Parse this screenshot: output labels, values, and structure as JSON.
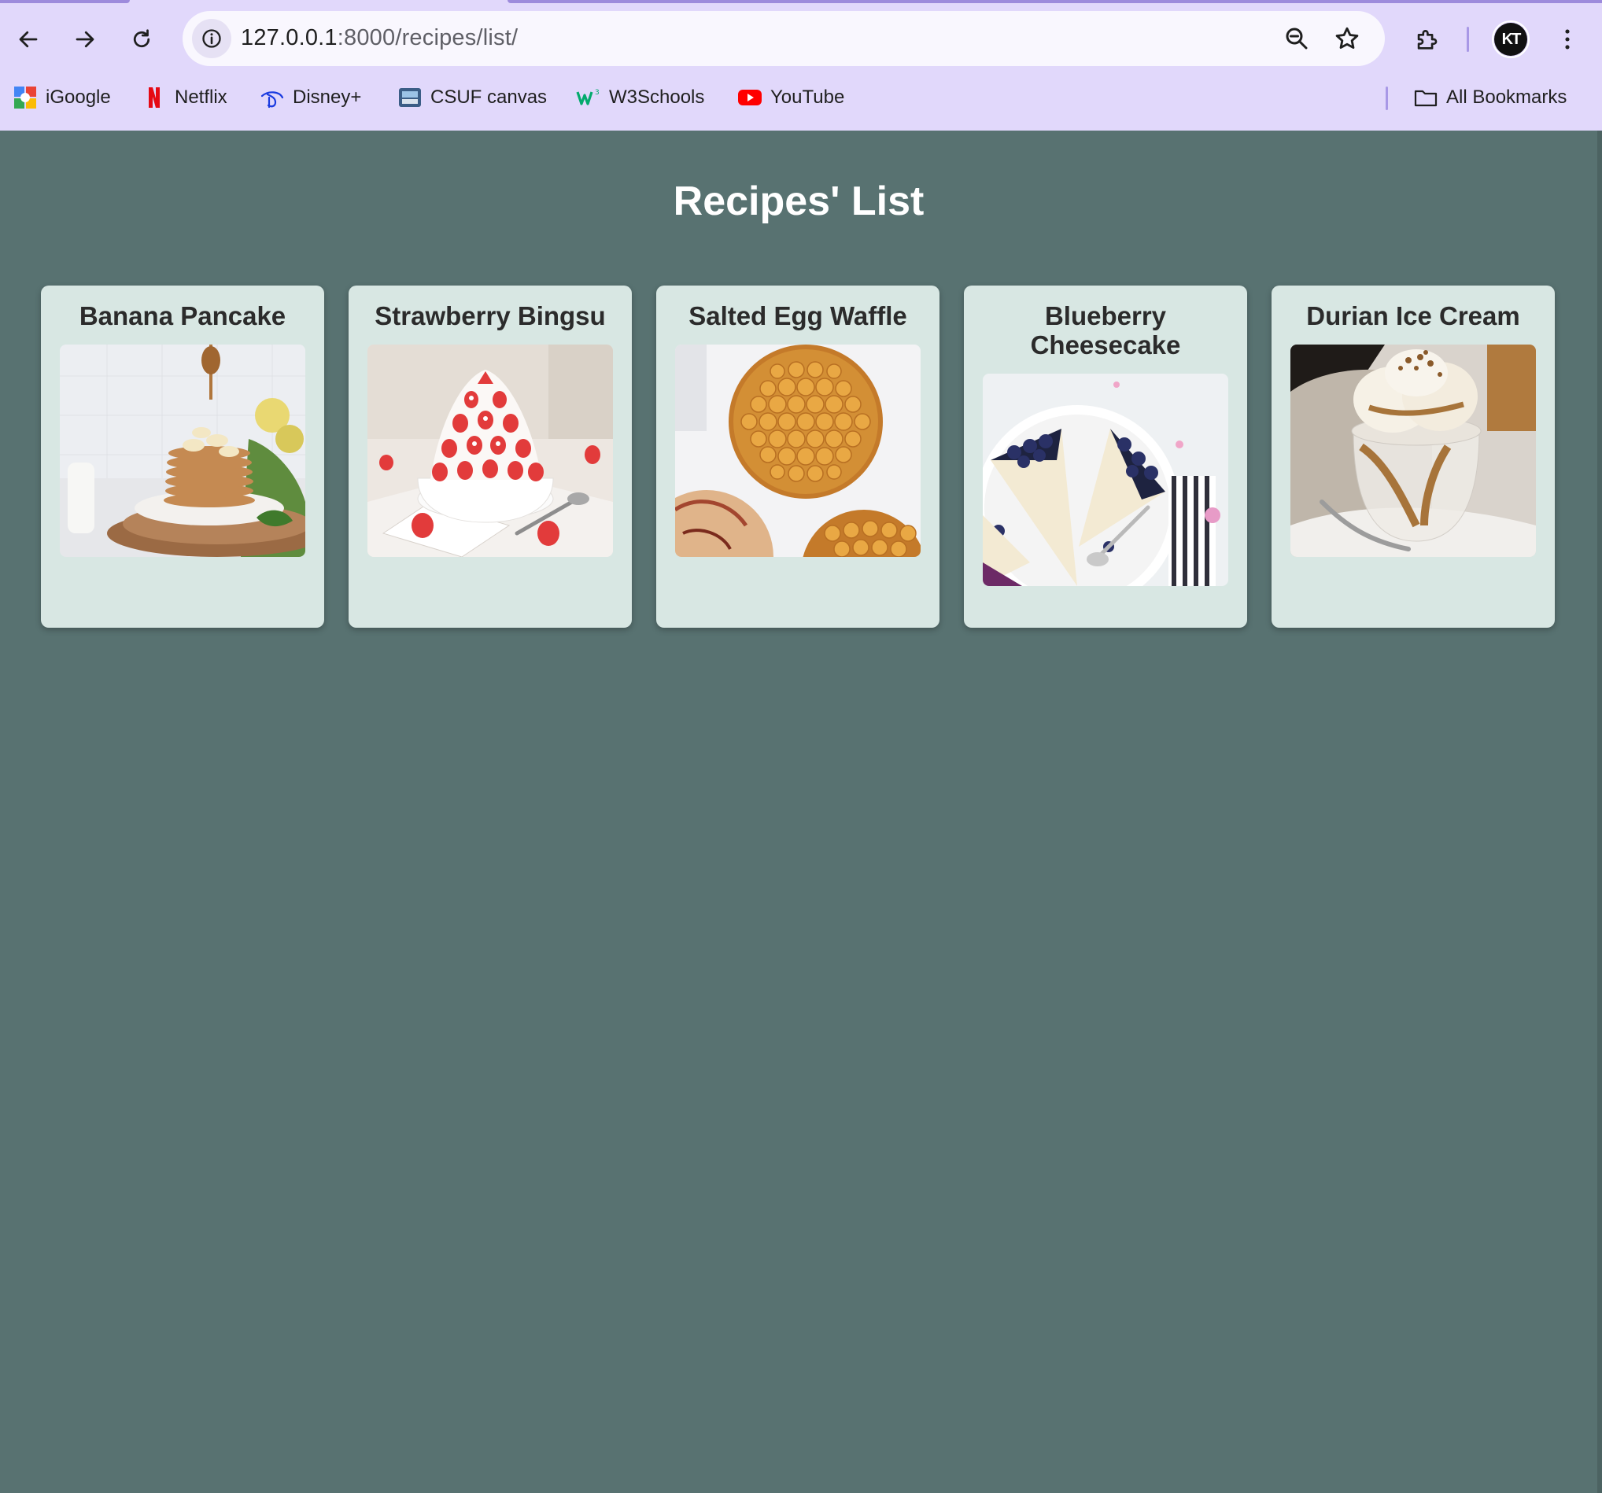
{
  "browser": {
    "url_host": "127.0.0.1",
    "url_path": ":8000/recipes/list/",
    "bookmarks": [
      {
        "label": "iGoogle",
        "icon": "igoogle-icon"
      },
      {
        "label": "Netflix",
        "icon": "netflix-icon"
      },
      {
        "label": "Disney+",
        "icon": "disney-icon"
      },
      {
        "label": "CSUF canvas",
        "icon": "csuf-icon"
      },
      {
        "label": "W3Schools",
        "icon": "w3schools-icon"
      },
      {
        "label": "YouTube",
        "icon": "youtube-icon"
      }
    ],
    "all_bookmarks_label": "All Bookmarks",
    "profile_initials": "KT",
    "accent": "#e1d8fb"
  },
  "page": {
    "title": "Recipes' List",
    "background": "#587271",
    "card_background": "#d8e7e3"
  },
  "recipes": [
    {
      "name": "Banana Pancake",
      "image": "banana-pancake-photo"
    },
    {
      "name": "Strawberry Bingsu",
      "image": "strawberry-bingsu-photo"
    },
    {
      "name": "Salted Egg Waffle",
      "image": "salted-egg-waffle-photo"
    },
    {
      "name": "Blueberry Cheesecake",
      "image": "blueberry-cheesecake-photo"
    },
    {
      "name": "Durian Ice Cream",
      "image": "durian-ice-cream-photo"
    }
  ]
}
